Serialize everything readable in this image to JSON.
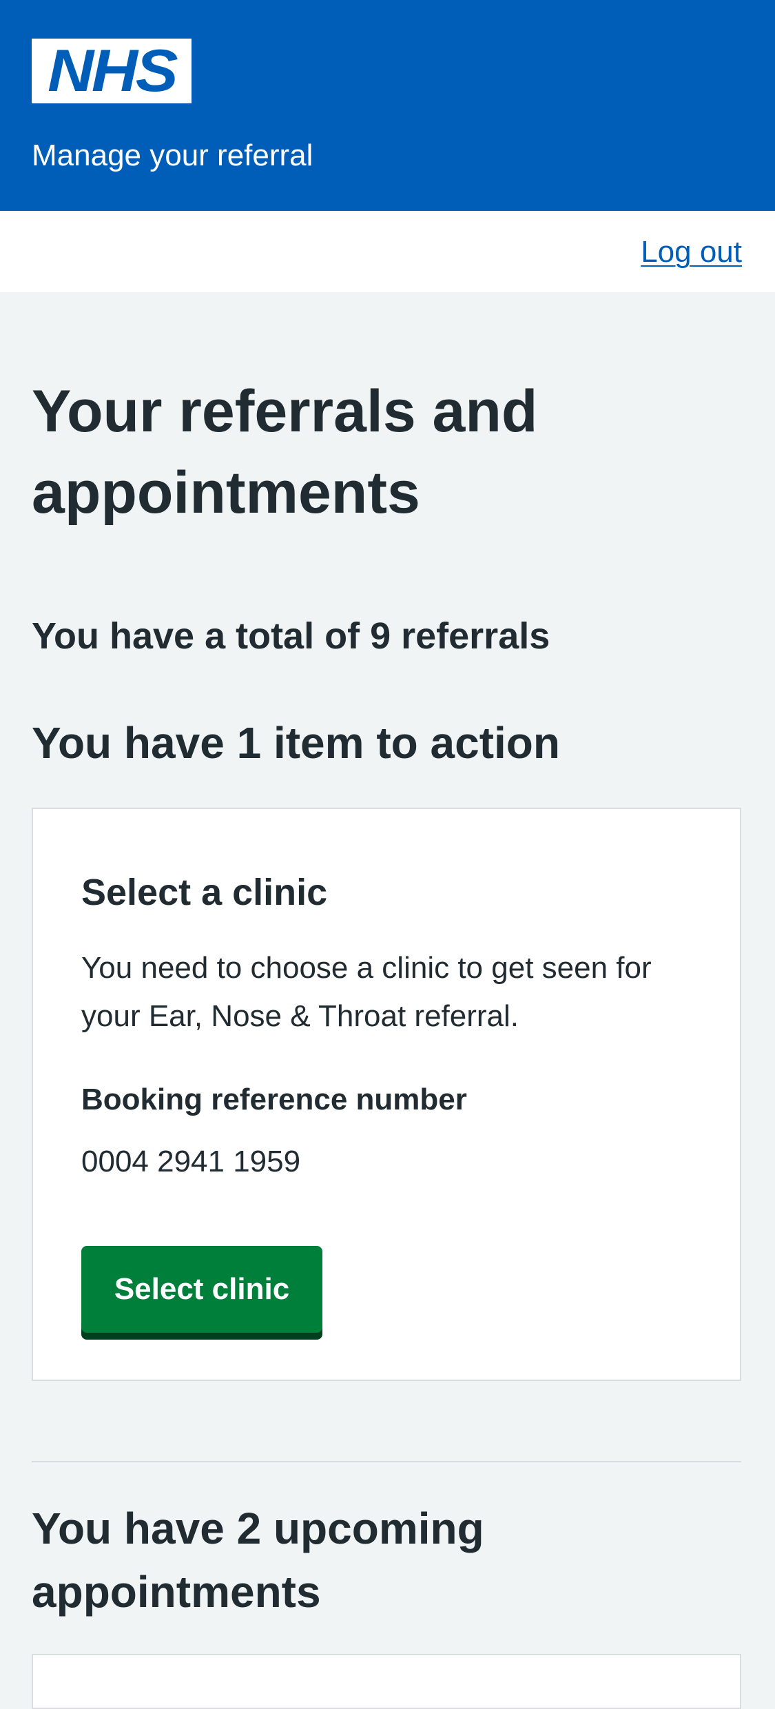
{
  "header": {
    "logo_text": "NHS",
    "service_name": "Manage your referral",
    "background_color": "#005eb8"
  },
  "subbar": {
    "logout_label": "Log out"
  },
  "main": {
    "title": "Your referrals and appointments",
    "total_text": "You have a total of 9 referrals",
    "action_heading": "You have 1 item to action",
    "action_card": {
      "title": "Select a clinic",
      "description": "You need to choose a clinic to get seen for your Ear, Nose & Throat referral.",
      "reference_label": "Booking reference number",
      "reference_value": "0004 2941 1959",
      "button_label": "Select clinic",
      "button_color": "#007f3b"
    },
    "upcoming_heading": "You have 2 upcoming appointments"
  }
}
